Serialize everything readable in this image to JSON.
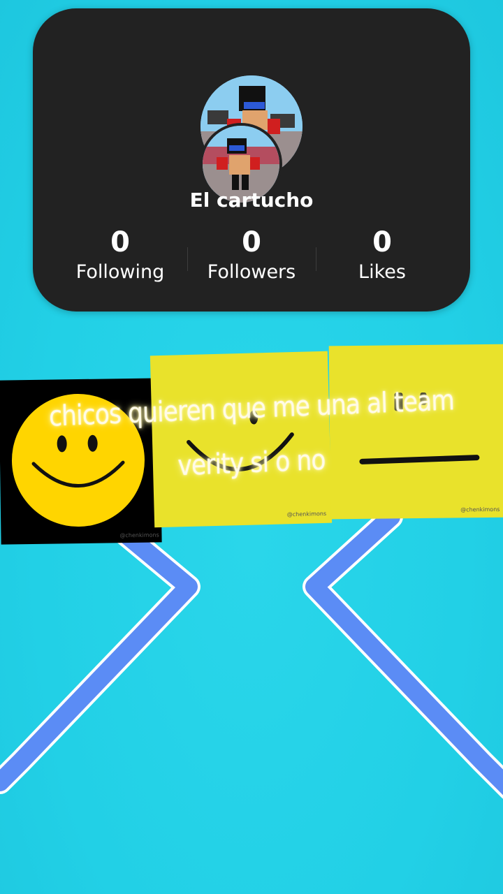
{
  "profile": {
    "username": "El cartucho",
    "stats": [
      {
        "value": "0",
        "label": "Following"
      },
      {
        "value": "0",
        "label": "Followers"
      },
      {
        "value": "0",
        "label": "Likes"
      }
    ]
  },
  "caption": {
    "line1": "chicos quieren que me una al team",
    "line2": "verity si o no"
  },
  "watermarks": [
    "@chenkimons",
    "@chenkimons",
    "@chenkimons"
  ],
  "colors": {
    "background": "#22d0e6",
    "card": "#222222",
    "panel_yellow": "#e9e22b",
    "smiley_yellow": "#ffd500",
    "line_blue": "#5b8cf5"
  }
}
